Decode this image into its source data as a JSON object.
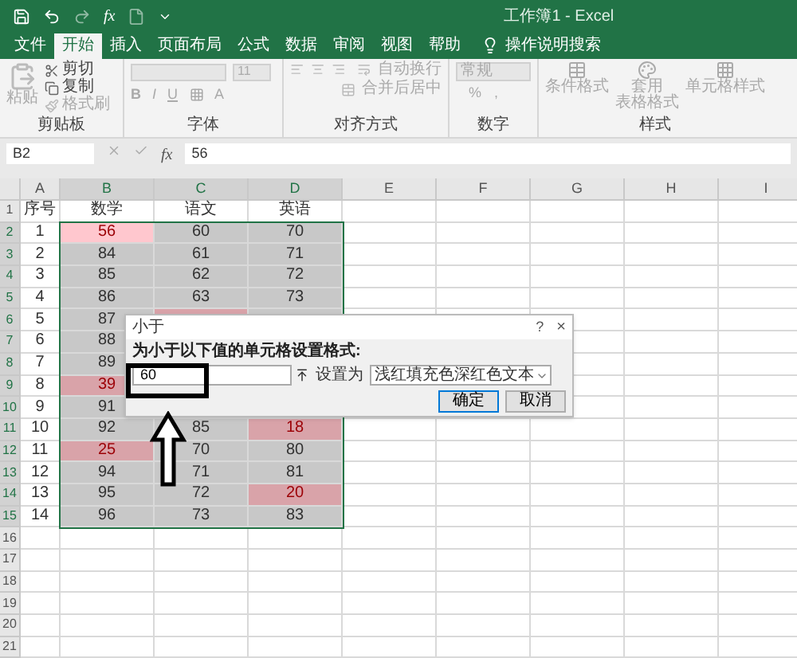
{
  "title_bar": {
    "title": "工作簿1 - Excel",
    "quick_fx": "fx"
  },
  "tabs": [
    {
      "label": "文件",
      "selected": false
    },
    {
      "label": "开始",
      "selected": true
    },
    {
      "label": "插入",
      "selected": false
    },
    {
      "label": "页面布局",
      "selected": false
    },
    {
      "label": "公式",
      "selected": false
    },
    {
      "label": "数据",
      "selected": false
    },
    {
      "label": "审阅",
      "selected": false
    },
    {
      "label": "视图",
      "selected": false
    },
    {
      "label": "帮助",
      "selected": false
    }
  ],
  "tell_me": "操作说明搜索",
  "clipboard": {
    "paste": "粘贴",
    "cut": "剪切",
    "copy": "复制",
    "format_painter": "格式刷",
    "label": "剪贴板"
  },
  "font": {
    "size": "11",
    "bold": "B",
    "italic": "I",
    "underline": "U",
    "font_color": "A",
    "label": "字体"
  },
  "alignment": {
    "wrap": "自动换行",
    "merge": "合并后居中",
    "label": "对齐方式"
  },
  "number": {
    "format": "常规",
    "percent": "%",
    "comma": ",",
    "label": "数字"
  },
  "styles": {
    "conditional": "条件格式",
    "table_format": [
      "套用",
      "表格格式"
    ],
    "cell_styles": "单元格样式",
    "label": "样式"
  },
  "formula_bar": {
    "name_box": "B2",
    "fx": "fx",
    "value": "56"
  },
  "columns": [
    {
      "label": "A",
      "selected": false
    },
    {
      "label": "B",
      "selected": true
    },
    {
      "label": "C",
      "selected": true
    },
    {
      "label": "D",
      "selected": true
    },
    {
      "label": "E",
      "selected": false
    },
    {
      "label": "F",
      "selected": false
    },
    {
      "label": "G",
      "selected": false
    },
    {
      "label": "H",
      "selected": false
    },
    {
      "label": "I",
      "selected": false
    }
  ],
  "rows": [
    {
      "number": "1",
      "selected": false,
      "cells": [
        {
          "text": "序号",
          "selected": false,
          "highlight": false
        },
        {
          "text": "数学",
          "selected": false,
          "highlight": false
        },
        {
          "text": "语文",
          "selected": false,
          "highlight": false
        },
        {
          "text": "英语",
          "selected": false,
          "highlight": false
        }
      ]
    },
    {
      "number": "2",
      "selected": true,
      "cells": [
        {
          "text": "1",
          "selected": false,
          "highlight": false
        },
        {
          "text": "56",
          "selected": false,
          "highlight": true
        },
        {
          "text": "60",
          "selected": true,
          "highlight": false
        },
        {
          "text": "70",
          "selected": true,
          "highlight": false
        }
      ]
    },
    {
      "number": "3",
      "selected": true,
      "cells": [
        {
          "text": "2",
          "selected": false,
          "highlight": false
        },
        {
          "text": "84",
          "selected": true,
          "highlight": false
        },
        {
          "text": "61",
          "selected": true,
          "highlight": false
        },
        {
          "text": "71",
          "selected": true,
          "highlight": false
        }
      ]
    },
    {
      "number": "4",
      "selected": true,
      "cells": [
        {
          "text": "3",
          "selected": false,
          "highlight": false
        },
        {
          "text": "85",
          "selected": true,
          "highlight": false
        },
        {
          "text": "62",
          "selected": true,
          "highlight": false
        },
        {
          "text": "72",
          "selected": true,
          "highlight": false
        }
      ]
    },
    {
      "number": "5",
      "selected": true,
      "cells": [
        {
          "text": "4",
          "selected": false,
          "highlight": false
        },
        {
          "text": "86",
          "selected": true,
          "highlight": false
        },
        {
          "text": "63",
          "selected": true,
          "highlight": false
        },
        {
          "text": "73",
          "selected": true,
          "highlight": false
        }
      ]
    },
    {
      "number": "6",
      "selected": true,
      "cells": [
        {
          "text": "5",
          "selected": false,
          "highlight": false
        },
        {
          "text": "87",
          "selected": true,
          "highlight": false
        },
        {
          "selected": true,
          "highlight": true
        },
        {
          "selected": true,
          "highlight": false
        }
      ]
    },
    {
      "number": "7",
      "selected": true,
      "cells": [
        {
          "text": "6",
          "selected": false,
          "highlight": false
        },
        {
          "text": "88",
          "selected": true,
          "highlight": false
        },
        null,
        null
      ]
    },
    {
      "number": "8",
      "selected": true,
      "cells": [
        {
          "text": "7",
          "selected": false,
          "highlight": false
        },
        {
          "text": "89",
          "selected": true,
          "highlight": false
        },
        null,
        null
      ]
    },
    {
      "number": "9",
      "selected": true,
      "cells": [
        {
          "text": "8",
          "selected": false,
          "highlight": false
        },
        {
          "text": "39",
          "selected": true,
          "highlight": true
        },
        null,
        null
      ]
    },
    {
      "number": "10",
      "selected": true,
      "cells": [
        {
          "text": "9",
          "selected": false,
          "highlight": false
        },
        {
          "text": "91",
          "selected": true,
          "highlight": false
        },
        null,
        null
      ]
    },
    {
      "number": "11",
      "selected": true,
      "cells": [
        {
          "text": "10",
          "selected": false,
          "highlight": false
        },
        {
          "text": "92",
          "selected": true,
          "highlight": false
        },
        {
          "text": "85",
          "selected": true,
          "highlight": false
        },
        {
          "text": "18",
          "selected": true,
          "highlight": true
        }
      ]
    },
    {
      "number": "12",
      "selected": true,
      "cells": [
        {
          "text": "11",
          "selected": false,
          "highlight": false
        },
        {
          "text": "25",
          "selected": true,
          "highlight": true
        },
        {
          "text": "70",
          "selected": true,
          "highlight": false
        },
        {
          "text": "80",
          "selected": true,
          "highlight": false
        }
      ]
    },
    {
      "number": "13",
      "selected": true,
      "cells": [
        {
          "text": "12",
          "selected": false,
          "highlight": false
        },
        {
          "text": "94",
          "selected": true,
          "highlight": false
        },
        {
          "text": "71",
          "selected": true,
          "highlight": false
        },
        {
          "text": "81",
          "selected": true,
          "highlight": false
        }
      ]
    },
    {
      "number": "14",
      "selected": true,
      "cells": [
        {
          "text": "13",
          "selected": false,
          "highlight": false
        },
        {
          "text": "95",
          "selected": true,
          "highlight": false
        },
        {
          "text": "72",
          "selected": true,
          "highlight": false
        },
        {
          "text": "20",
          "selected": true,
          "highlight": true
        }
      ]
    },
    {
      "number": "15",
      "selected": true,
      "cells": [
        {
          "text": "14",
          "selected": false,
          "highlight": false
        },
        {
          "text": "96",
          "selected": true,
          "highlight": false
        },
        {
          "text": "73",
          "selected": true,
          "highlight": false
        },
        {
          "text": "83",
          "selected": true,
          "highlight": false
        }
      ]
    },
    {
      "number": "16",
      "selected": false,
      "cells": []
    },
    {
      "number": "17",
      "selected": false,
      "cells": []
    },
    {
      "number": "18",
      "selected": false,
      "cells": []
    },
    {
      "number": "19",
      "selected": false,
      "cells": []
    },
    {
      "number": "20",
      "selected": false,
      "cells": []
    },
    {
      "number": "21",
      "selected": false,
      "cells": []
    }
  ],
  "dialog": {
    "title": "小于",
    "help": "?",
    "close": "×",
    "prompt": "为小于以下值的单元格设置格式:",
    "value": "60",
    "set_as": "设置为",
    "format": "浅红填充色深红色文本",
    "buttons": [
      {
        "label": "确定",
        "default": true
      },
      {
        "label": "取消",
        "default": false
      }
    ]
  }
}
